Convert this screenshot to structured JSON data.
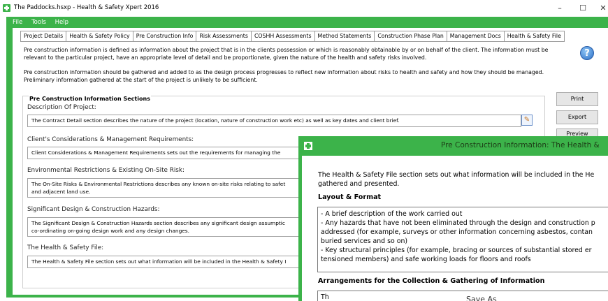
{
  "window": {
    "title": "The Paddocks.hsxp - Health & Safety Xpert 2016",
    "minimize": "–",
    "maximize": "☐",
    "close": "✕"
  },
  "menu": [
    "File",
    "Tools",
    "Help"
  ],
  "tabs": [
    "Project Details",
    "Health & Safety Policy",
    "Pre Construction Info",
    "Risk Assessments",
    "COSHH Assessments",
    "Method Statements",
    "Construction Phase Plan",
    "Management Docs",
    "Health & Safety File"
  ],
  "active_tab": "Pre Construction Info",
  "intro": {
    "p1_line1": "Pre construction information is defined as information about the project that is in the clients possession or which is reasonably obtainable by or on behalf of the client. The information must be",
    "p1_line2": "relevant to the particular project, have an appropriate level of detail and be proportionate, given the nature of the health and safety risks involved.",
    "p2_line1": "Pre construction information should be gathered and added to as the design process progresses to reflect new information about risks to health and safety and how they should be managed.",
    "p2_line2": "Preliminary information gathered at the start of the project is unlikely to be sufficient."
  },
  "help_icon": "?",
  "sections_title": "Pre Construction Information Sections",
  "sections": [
    {
      "label": "Description Of Project:",
      "lines": [
        "The Contract Detail section describes the nature of the project (location, nature of construction work etc) as well as key dates and client brief."
      ]
    },
    {
      "label": "Client's Considerations & Management Requirements:",
      "lines": [
        "Client Considerations & Management Requirements sets out the requirements for managing the"
      ]
    },
    {
      "label": "Environmental Restrictions & Existing On-Site Risk:",
      "lines": [
        "The On-Site Risks & Environmental Restrictions describes any known on-site risks relating to safet",
        "and adjacent land use."
      ]
    },
    {
      "label": "Significant Design & Construction Hazards:",
      "lines": [
        "The Significant Design & Construction Hazards section describes any significant design assumptic",
        "co-ordinating on-going design work and any design changes."
      ]
    },
    {
      "label": "The Health & Safety File:",
      "lines": [
        "The Health & Safety File section sets out what information will be included in the Health & Safety I"
      ]
    }
  ],
  "buttons": {
    "print": "Print",
    "export": "Export",
    "preview": "Preview"
  },
  "dialog": {
    "title": "Pre Construction Information: The Health &",
    "intro_line1": "The Health & Safety File section sets out what information will be included in the He",
    "intro_line2": "gathered and presented.",
    "layout_heading": "Layout & Format",
    "layout_lines": [
      "- A brief description of the work carried out",
      "- Any hazards that have not been eliminated through the design and construction p",
      "addressed (for example, surveys or other information concerning asbestos, contan",
      "buried services and so on)",
      "- Key structural principles (for example, bracing or sources of substantial stored er",
      "tensioned members) and safe working loads for floors and roofs"
    ],
    "arrange_heading": "Arrangements for the Collection & Gathering of Information",
    "arrange_text": "Th",
    "save_as": "Save As"
  }
}
